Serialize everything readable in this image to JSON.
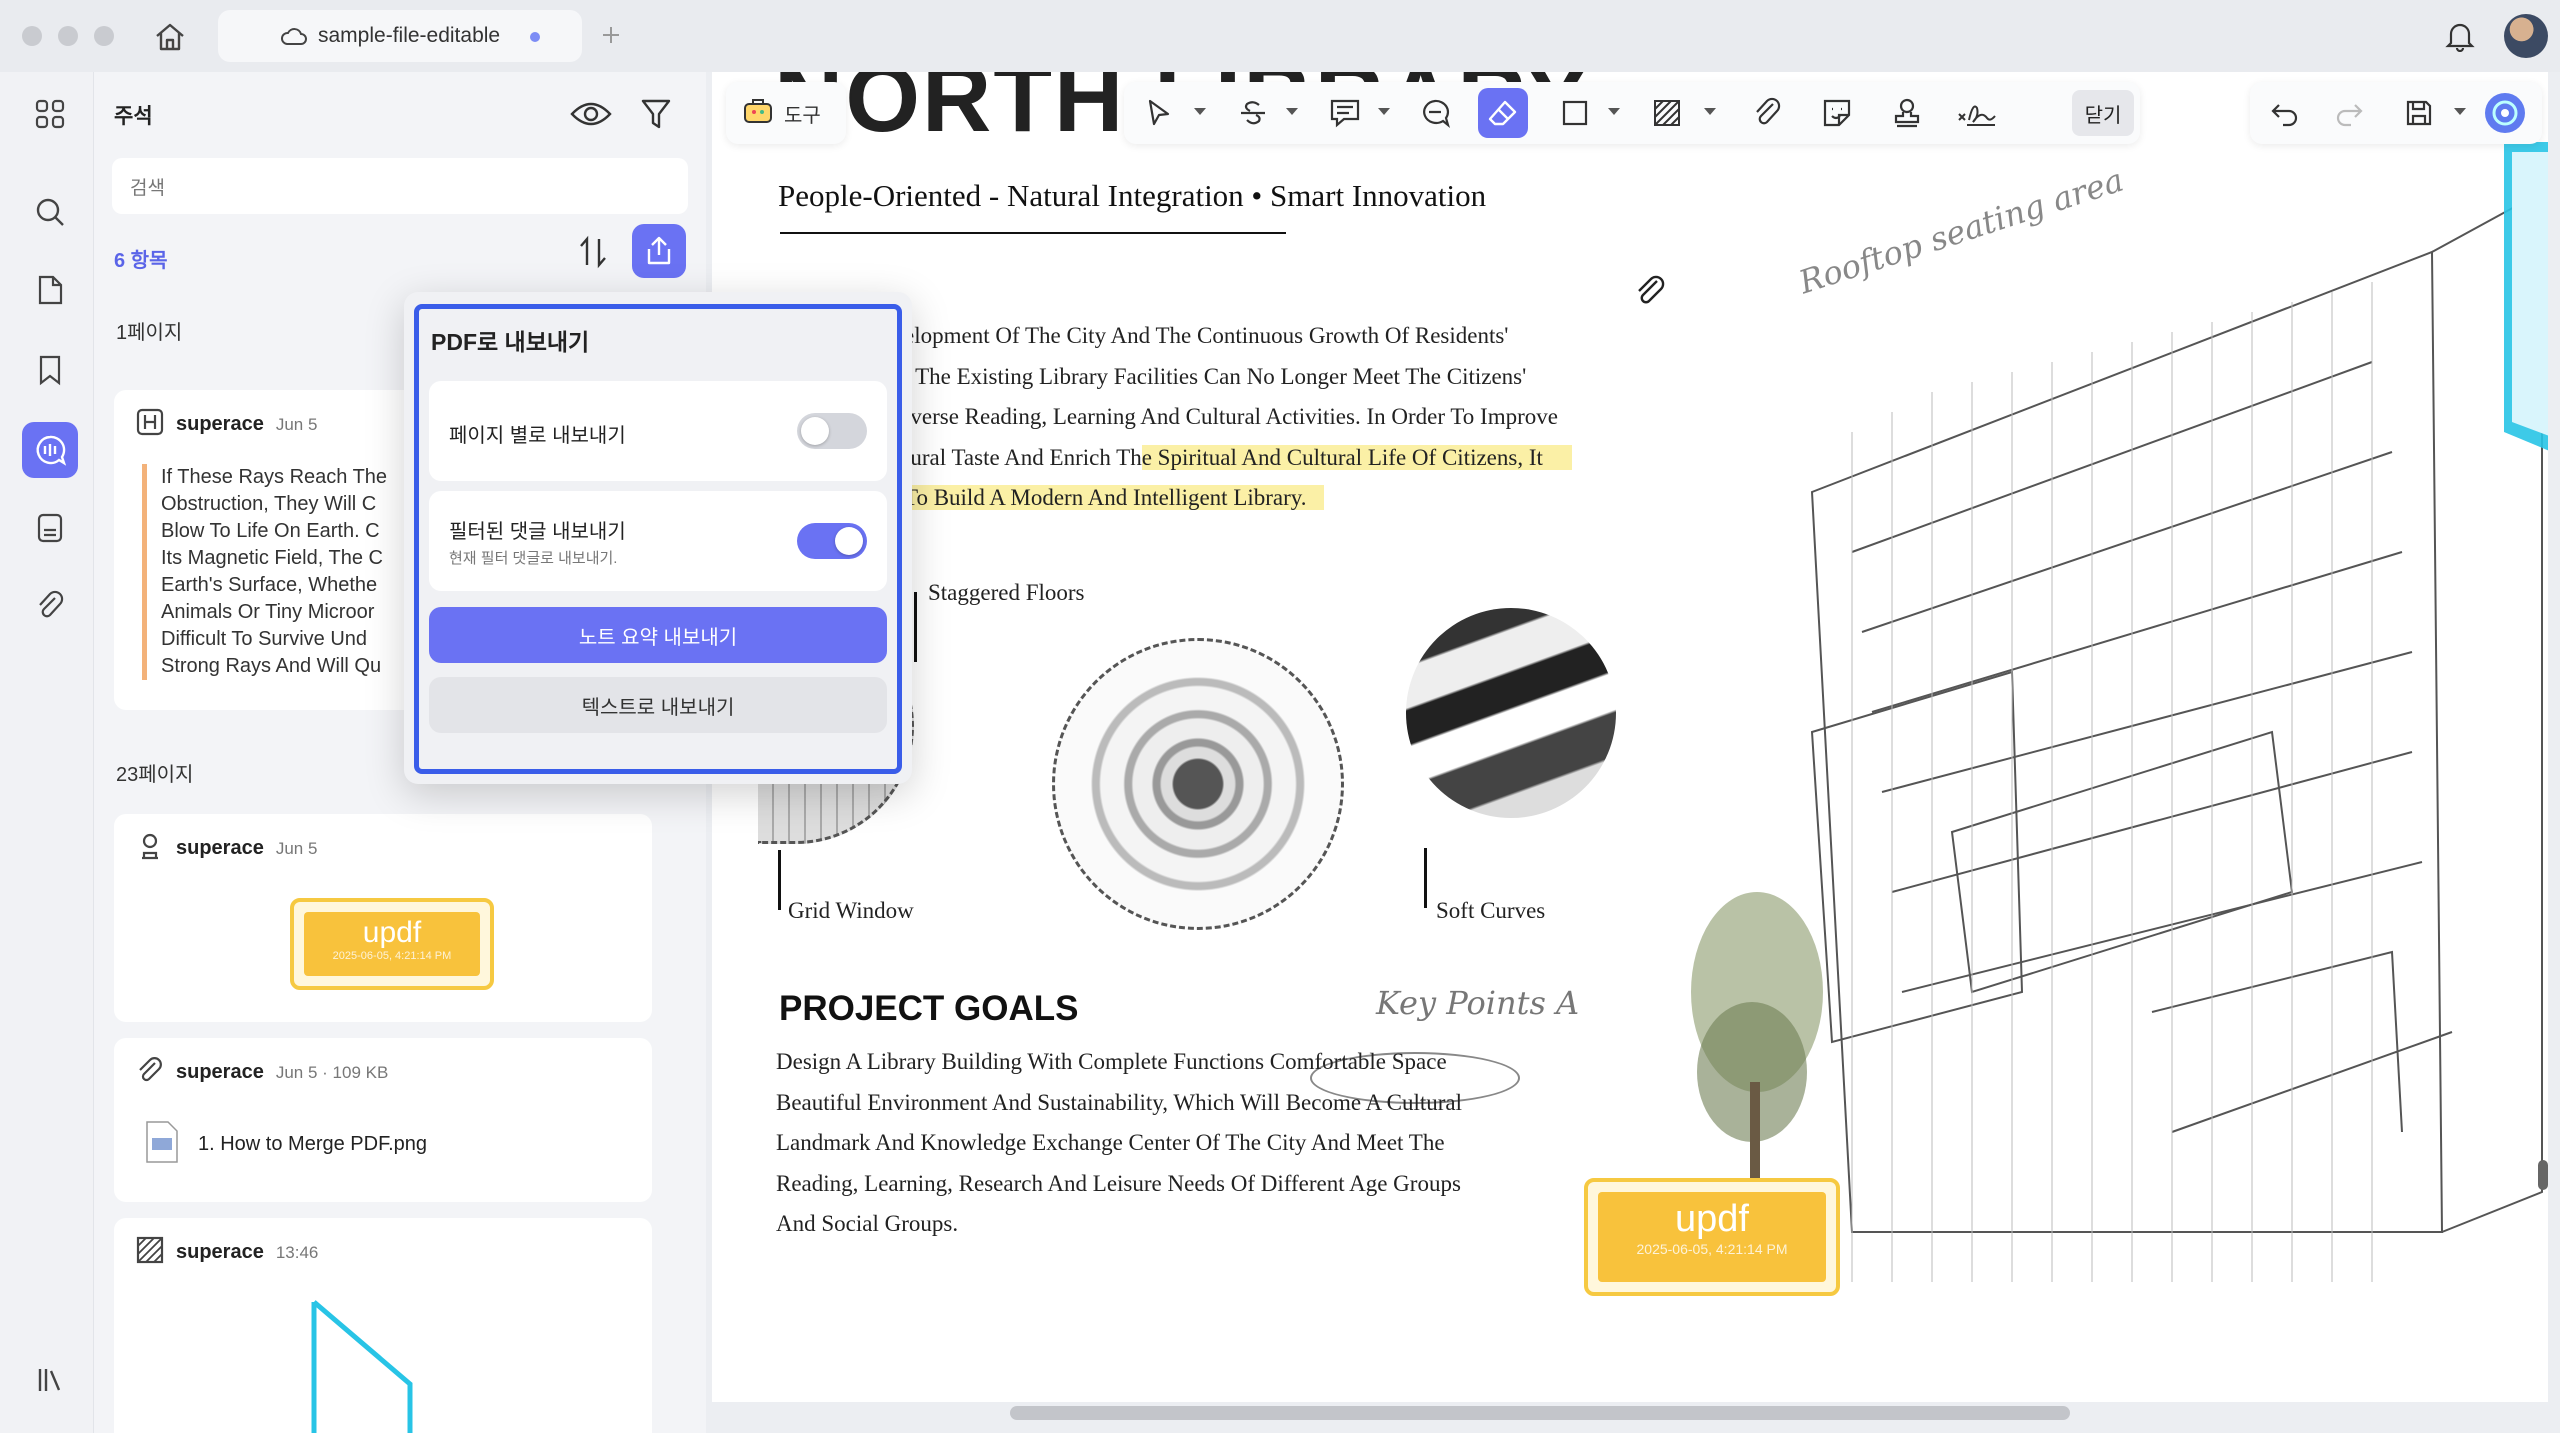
{
  "window": {
    "tab_title": "sample-file-editable"
  },
  "panel": {
    "title": "주석",
    "search_placeholder": "검색",
    "count_label": "6 항목",
    "page1_label": "1페이지",
    "page23_label": "23페이지",
    "cards": [
      {
        "author": "superace",
        "date": "Jun 5",
        "quote_lines": [
          "If These Rays Reach The",
          "Obstruction, They Will C",
          "Blow To Life On Earth. C",
          "Its Magnetic Field, The C",
          "Earth's Surface, Whethe",
          "Animals Or Tiny Microor",
          "Difficult To Survive Und",
          "Strong Rays And Will Qu"
        ]
      },
      {
        "author": "superace",
        "date": "Jun 5",
        "stamp_text": "updf",
        "stamp_date": "2025-06-05, 4:21:14 PM"
      },
      {
        "author": "superace",
        "date": "Jun 5 · 109 KB",
        "file_name": "1. How to Merge PDF.png"
      },
      {
        "author": "superace",
        "date": "13:46"
      }
    ]
  },
  "popup": {
    "title": "PDF로 내보내기",
    "option1_label": "페이지 별로 내보내기",
    "option1_on": false,
    "option2_label": "필터된 댓글 내보내기",
    "option2_sub": "현재 필터 댓글로 내보내기.",
    "option2_on": true,
    "primary_button": "노트 요약 내보내기",
    "secondary_button": "텍스트로 내보내기"
  },
  "toolbar": {
    "tools_label": "도구",
    "close_label": "닫기"
  },
  "document": {
    "heading_fragment": "NORTH LIBRARY",
    "subtitle": "People-Oriented - Natural Integration • Smart Innovation",
    "para1": [
      "elopment Of The City And The Continuous Growth Of Residents'",
      ", The Existing Library Facilities Can No Longer Meet The Citizens'",
      "iverse Reading, Learning And Cultural Activities. In Order To Improve",
      "tural Taste And Enrich Th"
    ],
    "para1_hl_a": "e Spiritual And Cultural Life Of Citizens, It",
    "para1_hl_b": "To Build A Modern And Intelligent Library.",
    "caption_staggered": "Staggered Floors",
    "caption_grid": "Grid Window",
    "caption_soft": "Soft Curves",
    "goals_title": "PROJECT GOALS",
    "goals_lines": [
      "Design A Library Building With Complete Functions Comfortable Space",
      "Beautiful Environment And Sustainability, Which Will Become A Cultural",
      "Landmark And Knowledge Exchange Center Of The City And Meet The",
      "Reading, Learning, Research And Leisure Needs Of Different Age Groups",
      "And Social Groups."
    ],
    "handwriting_rooftop": "Rooftop seating area",
    "handwriting_keypoints": "Key Points A",
    "stamp_text": "updf",
    "stamp_date": "2025-06-05, 4:21:14 PM"
  },
  "colors": {
    "accent": "#6a72f3",
    "highlight": "#fbf0a6",
    "stamp": "#f8c23c",
    "popup_border": "#3a5de9",
    "cyan_shape": "#28c4e6"
  },
  "icons": [
    "home-icon",
    "cloud-icon",
    "plus-icon",
    "bell-icon",
    "grid-icon",
    "search-icon",
    "page-icon",
    "bookmark-icon",
    "comment-icon",
    "doc-icon",
    "paperclip-icon",
    "library-icon",
    "eye-icon",
    "filter-icon",
    "sort-icon",
    "share-icon"
  ]
}
